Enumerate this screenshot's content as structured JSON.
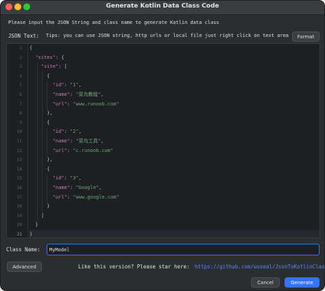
{
  "window": {
    "title": "Generate Kotlin Data Class Code"
  },
  "instructions": "Please input the JSON String and class name to generate Kotlin data class",
  "json_text_label": "JSON Text:",
  "tips": "Tips: you can use JSON string, http urls or local file just right click on text area",
  "format_label": "Format",
  "editor": {
    "current_line": 21,
    "lines": [
      {
        "n": "1",
        "t": [
          [
            "p",
            "{"
          ]
        ]
      },
      {
        "n": "2",
        "t": [
          [
            "p",
            "  "
          ],
          [
            "k",
            "\"sites\""
          ],
          [
            "p",
            ": {"
          ]
        ]
      },
      {
        "n": "3",
        "t": [
          [
            "p",
            "    "
          ],
          [
            "k",
            "\"site\""
          ],
          [
            "p",
            ": ["
          ]
        ]
      },
      {
        "n": "4",
        "t": [
          [
            "p",
            "      {"
          ]
        ]
      },
      {
        "n": "5",
        "t": [
          [
            "p",
            "        "
          ],
          [
            "k",
            "\"id\""
          ],
          [
            "p",
            ": "
          ],
          [
            "s",
            "\"1\""
          ],
          [
            "p",
            ","
          ]
        ]
      },
      {
        "n": "6",
        "t": [
          [
            "p",
            "        "
          ],
          [
            "k",
            "\"name\""
          ],
          [
            "p",
            ": "
          ],
          [
            "s",
            "\"菜鸟教程\""
          ],
          [
            "p",
            ","
          ]
        ]
      },
      {
        "n": "7",
        "t": [
          [
            "p",
            "        "
          ],
          [
            "k",
            "\"url\""
          ],
          [
            "p",
            ": "
          ],
          [
            "s",
            "\"www.runoob.com\""
          ]
        ]
      },
      {
        "n": "8",
        "t": [
          [
            "p",
            "      },"
          ]
        ]
      },
      {
        "n": "9",
        "t": [
          [
            "p",
            "      {"
          ]
        ]
      },
      {
        "n": "10",
        "t": [
          [
            "p",
            "        "
          ],
          [
            "k",
            "\"id\""
          ],
          [
            "p",
            ": "
          ],
          [
            "s",
            "\"2\""
          ],
          [
            "p",
            ","
          ]
        ]
      },
      {
        "n": "11",
        "t": [
          [
            "p",
            "        "
          ],
          [
            "k",
            "\"name\""
          ],
          [
            "p",
            ": "
          ],
          [
            "s",
            "\"菜鸟工具\""
          ],
          [
            "p",
            ","
          ]
        ]
      },
      {
        "n": "12",
        "t": [
          [
            "p",
            "        "
          ],
          [
            "k",
            "\"url\""
          ],
          [
            "p",
            ": "
          ],
          [
            "s",
            "\"c.runoob.com\""
          ]
        ]
      },
      {
        "n": "13",
        "t": [
          [
            "p",
            "      },"
          ]
        ]
      },
      {
        "n": "14",
        "t": [
          [
            "p",
            "      {"
          ]
        ]
      },
      {
        "n": "15",
        "t": [
          [
            "p",
            "        "
          ],
          [
            "k",
            "\"id\""
          ],
          [
            "p",
            ": "
          ],
          [
            "s",
            "\"3\""
          ],
          [
            "p",
            ","
          ]
        ]
      },
      {
        "n": "16",
        "t": [
          [
            "p",
            "        "
          ],
          [
            "k",
            "\"name\""
          ],
          [
            "p",
            ": "
          ],
          [
            "s",
            "\"Google\""
          ],
          [
            "p",
            ","
          ]
        ]
      },
      {
        "n": "17",
        "t": [
          [
            "p",
            "        "
          ],
          [
            "k",
            "\"url\""
          ],
          [
            "p",
            ": "
          ],
          [
            "s",
            "\"www.google.com\""
          ]
        ]
      },
      {
        "n": "18",
        "t": [
          [
            "p",
            "      }"
          ]
        ]
      },
      {
        "n": "19",
        "t": [
          [
            "p",
            "    ]"
          ]
        ]
      },
      {
        "n": "20",
        "t": [
          [
            "p",
            "  }"
          ]
        ]
      },
      {
        "n": "21",
        "t": [
          [
            "p",
            "}"
          ]
        ]
      }
    ]
  },
  "class_name_label": "Class Name:",
  "class_name_value": "MyModel",
  "advanced_label": "Advanced",
  "star_text": "Like this version? Please star here:",
  "star_link": "https://github.com/wuseal/JsonToKotlinClass",
  "cancel_label": "Cancel",
  "generate_label": "Generate",
  "colors": {
    "accent": "#3574f0",
    "key": "#c77dbb",
    "string": "#6aab73",
    "punctuation": "#bcbec4",
    "link": "#548af7",
    "background": "#2b2d30"
  }
}
